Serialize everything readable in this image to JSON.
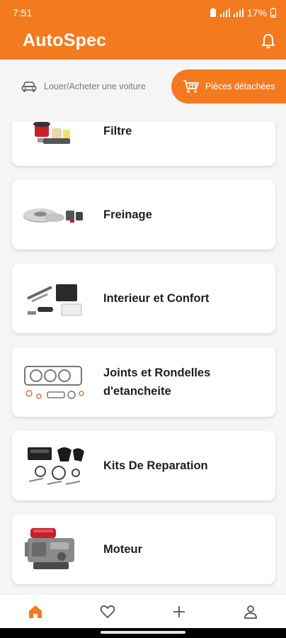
{
  "status": {
    "time": "7:51",
    "battery": "17%"
  },
  "header": {
    "title": "AutoSpec"
  },
  "tabs": [
    {
      "label": "Louer/Acheter une voiture",
      "icon": "car-icon",
      "active": false
    },
    {
      "label": "Pièces détachées",
      "icon": "cart-icon",
      "active": true
    }
  ],
  "categories": [
    {
      "label": "Filtre",
      "image": "filter-parts"
    },
    {
      "label": "Freinage",
      "image": "brake-parts"
    },
    {
      "label": "Interieur et Confort",
      "image": "interior-parts"
    },
    {
      "label": "Joints et Rondelles d'etancheite",
      "image": "gasket-parts"
    },
    {
      "label": "Kits De Reparation",
      "image": "repair-kit-parts"
    },
    {
      "label": "Moteur",
      "image": "engine-parts"
    }
  ],
  "bottom_nav": [
    {
      "icon": "home-icon",
      "active": true
    },
    {
      "icon": "heart-icon",
      "active": false
    },
    {
      "icon": "plus-icon",
      "active": false
    },
    {
      "icon": "profile-icon",
      "active": false
    }
  ],
  "colors": {
    "accent": "#f37a1f",
    "background": "#f5f5f5",
    "card": "#ffffff",
    "text": "#1e1e1e"
  }
}
